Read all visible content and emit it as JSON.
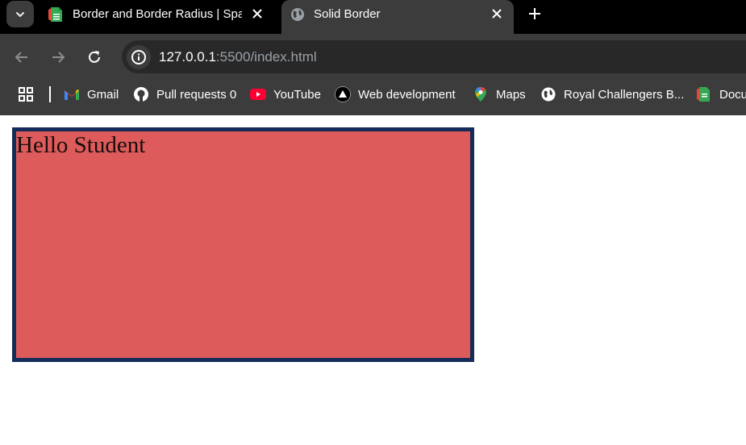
{
  "browser": {
    "tabs": [
      {
        "title": "Border and Border Radius | Spar",
        "active": false,
        "favicon": "sheets-icon"
      },
      {
        "title": "Solid Border",
        "active": true,
        "favicon": "globe-icon"
      }
    ],
    "address": {
      "host": "127.0.0.1",
      "rest": ":5500/index.html"
    },
    "bookmarks": [
      {
        "label": "Gmail",
        "icon": "gmail-icon"
      },
      {
        "label": "Pull requests 0",
        "icon": "github-icon"
      },
      {
        "label": "YouTube",
        "icon": "youtube-icon"
      },
      {
        "label": "Web development",
        "icon": "triangle-icon"
      },
      {
        "label": "Maps",
        "icon": "maps-pin-icon"
      },
      {
        "label": "Royal Challengers B...",
        "icon": "globe-icon"
      },
      {
        "label": "Docu",
        "icon": "docs-icon"
      }
    ]
  },
  "content": {
    "box_text": "Hello Student",
    "colors": {
      "box_bg": "#dd5b5b",
      "box_border": "#152b59"
    }
  }
}
